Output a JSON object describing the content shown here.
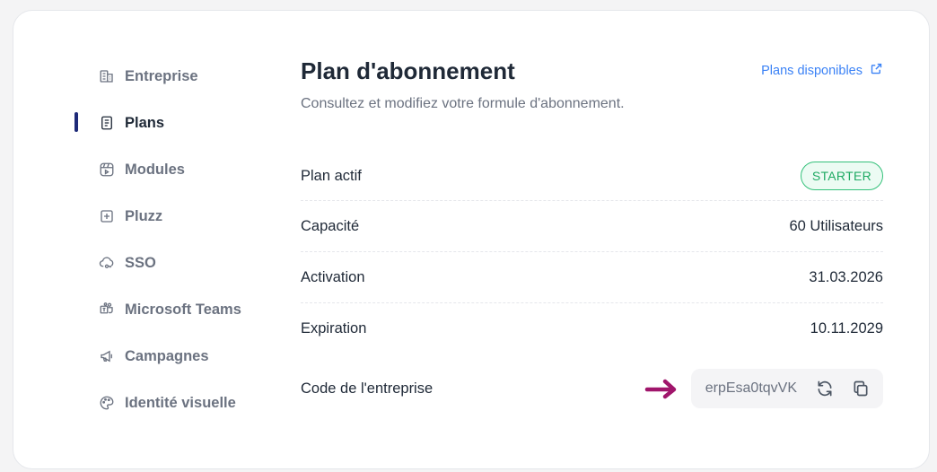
{
  "sidebar": {
    "items": [
      {
        "label": "Entreprise",
        "icon": "building-icon",
        "active": false
      },
      {
        "label": "Plans",
        "icon": "document-icon",
        "active": true
      },
      {
        "label": "Modules",
        "icon": "modules-icon",
        "active": false
      },
      {
        "label": "Pluzz",
        "icon": "plus-square-icon",
        "active": false
      },
      {
        "label": "SSO",
        "icon": "cloud-key-icon",
        "active": false
      },
      {
        "label": "Microsoft Teams",
        "icon": "teams-icon",
        "active": false
      },
      {
        "label": "Campagnes",
        "icon": "megaphone-icon",
        "active": false
      },
      {
        "label": "Identité visuelle",
        "icon": "palette-icon",
        "active": false
      }
    ]
  },
  "main": {
    "title": "Plan d'abonnement",
    "subtitle": "Consultez et modifiez votre formule d'abonnement.",
    "plans_link": {
      "label": "Plans disponibles",
      "icon": "external-link-icon"
    },
    "rows": {
      "plan": {
        "label": "Plan actif",
        "value": "STARTER"
      },
      "capacity": {
        "label": "Capacité",
        "value": "60 Utilisateurs"
      },
      "activation": {
        "label": "Activation",
        "value": "31.03.2026"
      },
      "expiration": {
        "label": "Expiration",
        "value": "10.11.2029"
      },
      "code": {
        "label": "Code de l'entreprise",
        "value": "erpEsa0tqvVK"
      }
    }
  },
  "colors": {
    "accent_bar": "#1e2a78",
    "link": "#3b82f6",
    "badge_green": "#34c17a",
    "annotation_arrow": "#a0156b"
  }
}
